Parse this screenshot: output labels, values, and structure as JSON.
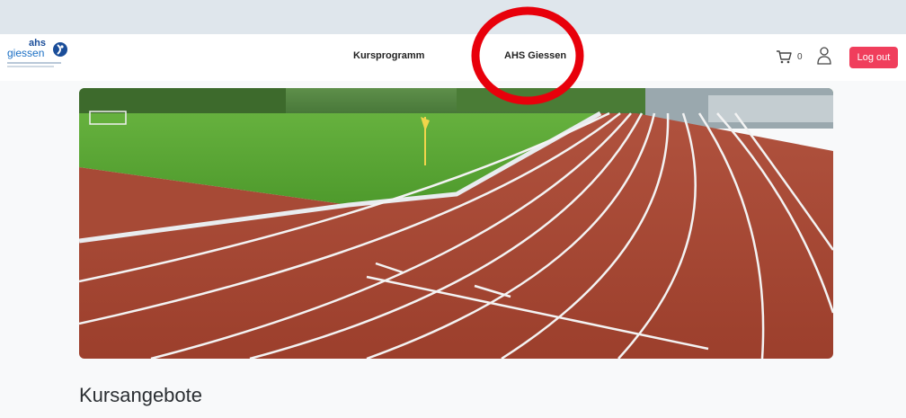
{
  "navbar": {
    "logo": {
      "name": "ahs giessen",
      "line1": "ahs",
      "line2": "giessen"
    },
    "links": [
      {
        "label": "Kursprogramm"
      },
      {
        "label": "AHS Giessen"
      }
    ],
    "cart": {
      "count": "0",
      "icon": "cart-icon"
    },
    "user": {
      "icon": "user-icon"
    },
    "logout_label": "Log out"
  },
  "main": {
    "heading": "Kursangebote"
  },
  "colors": {
    "accent": "#f03e5c",
    "annotation": "#e8000b",
    "brand_blue": "#1a6fc4"
  }
}
